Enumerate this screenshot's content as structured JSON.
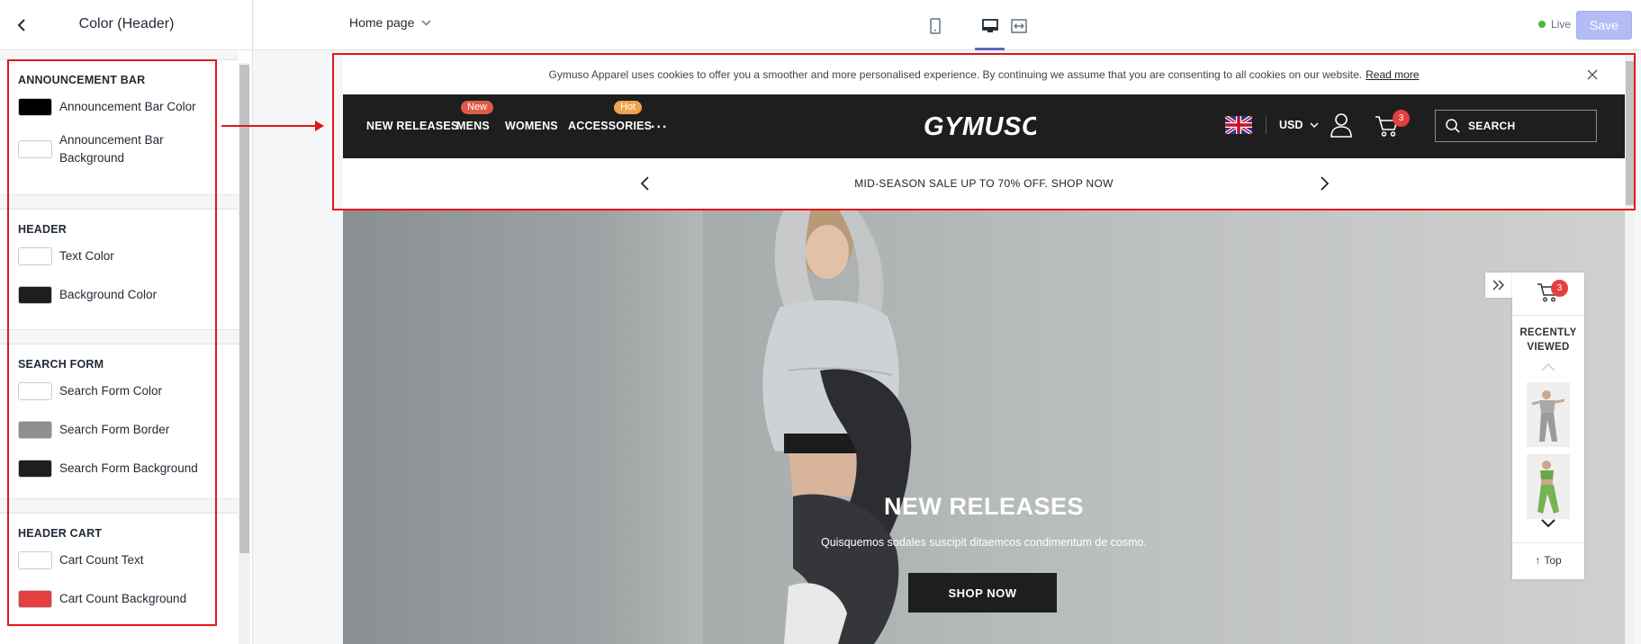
{
  "sidebar": {
    "title": "Color (Header)",
    "sections": [
      {
        "heading": "ANNOUNCEMENT BAR",
        "items": [
          {
            "label": "Announcement Bar Color",
            "swatch": "#000000"
          },
          {
            "label": "Announcement Bar Background",
            "swatch": "#ffffff"
          }
        ]
      },
      {
        "heading": "HEADER",
        "items": [
          {
            "label": "Text Color",
            "swatch": "#ffffff"
          },
          {
            "label": "Background Color",
            "swatch": "#1e1e1e"
          }
        ]
      },
      {
        "heading": "SEARCH FORM",
        "items": [
          {
            "label": "Search Form Color",
            "swatch": "#ffffff"
          },
          {
            "label": "Search Form Border",
            "swatch": "#8f8f8f"
          },
          {
            "label": "Search Form Background",
            "swatch": "#1e1e1e"
          }
        ]
      },
      {
        "heading": "HEADER CART",
        "items": [
          {
            "label": "Cart Count Text",
            "swatch": "#ffffff"
          },
          {
            "label": "Cart Count Background",
            "swatch": "#e53e3e"
          }
        ]
      }
    ]
  },
  "topbar": {
    "page_selector": "Home page",
    "live_label": "Live",
    "save_label": "Save",
    "active_view": "desktop"
  },
  "store": {
    "cookie_text": "Gymuso Apparel uses cookies to offer you a smoother and more personalised experience. By continuing we assume that you are consenting to all cookies on our website.",
    "cookie_link": "Read more",
    "nav": [
      {
        "label": "NEW RELEASES",
        "badge": ""
      },
      {
        "label": "MENS",
        "badge": "New",
        "badge_color": "#e05a47"
      },
      {
        "label": "WOMENS",
        "badge": ""
      },
      {
        "label": "ACCESSORIES",
        "badge": "Hot",
        "badge_color": "#f0a34a"
      }
    ],
    "nav_more": "...",
    "logo": "GYMUSO",
    "currency": "USD",
    "cart_count": "3",
    "search_placeholder": "SEARCH",
    "promo_text": "MID-SEASON SALE UP TO 70% OFF. SHOP NOW",
    "hero": {
      "title": "NEW RELEASES",
      "subtitle": "Quisquemos sodales suscipit ditaemcos condimentum de cosmo.",
      "button": "SHOP NOW"
    },
    "recently_viewed": {
      "title_line1": "RECENTLY",
      "title_line2": "VIEWED",
      "cart_count": "3",
      "top_label": "Top"
    }
  },
  "colors": {
    "accent": "#5c6ac4",
    "highlight": "#e3161b",
    "header_bg": "#1e1e1e",
    "badge_red": "#e53e3e"
  }
}
